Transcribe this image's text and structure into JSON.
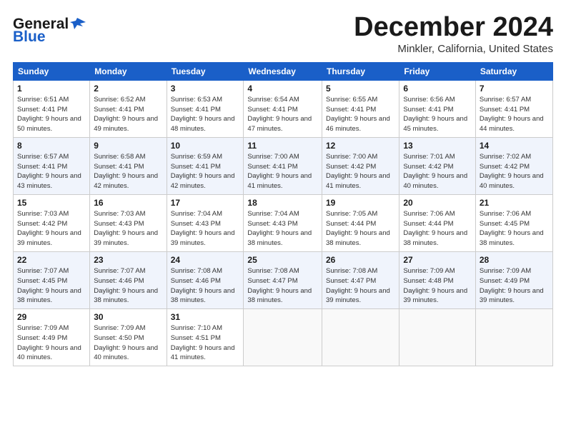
{
  "logo": {
    "general": "General",
    "blue": "Blue",
    "tagline": "Blue"
  },
  "title": "December 2024",
  "subtitle": "Minkler, California, United States",
  "headers": [
    "Sunday",
    "Monday",
    "Tuesday",
    "Wednesday",
    "Thursday",
    "Friday",
    "Saturday"
  ],
  "weeks": [
    [
      {
        "day": "1",
        "sunrise": "Sunrise: 6:51 AM",
        "sunset": "Sunset: 4:41 PM",
        "daylight": "Daylight: 9 hours and 50 minutes."
      },
      {
        "day": "2",
        "sunrise": "Sunrise: 6:52 AM",
        "sunset": "Sunset: 4:41 PM",
        "daylight": "Daylight: 9 hours and 49 minutes."
      },
      {
        "day": "3",
        "sunrise": "Sunrise: 6:53 AM",
        "sunset": "Sunset: 4:41 PM",
        "daylight": "Daylight: 9 hours and 48 minutes."
      },
      {
        "day": "4",
        "sunrise": "Sunrise: 6:54 AM",
        "sunset": "Sunset: 4:41 PM",
        "daylight": "Daylight: 9 hours and 47 minutes."
      },
      {
        "day": "5",
        "sunrise": "Sunrise: 6:55 AM",
        "sunset": "Sunset: 4:41 PM",
        "daylight": "Daylight: 9 hours and 46 minutes."
      },
      {
        "day": "6",
        "sunrise": "Sunrise: 6:56 AM",
        "sunset": "Sunset: 4:41 PM",
        "daylight": "Daylight: 9 hours and 45 minutes."
      },
      {
        "day": "7",
        "sunrise": "Sunrise: 6:57 AM",
        "sunset": "Sunset: 4:41 PM",
        "daylight": "Daylight: 9 hours and 44 minutes."
      }
    ],
    [
      {
        "day": "8",
        "sunrise": "Sunrise: 6:57 AM",
        "sunset": "Sunset: 4:41 PM",
        "daylight": "Daylight: 9 hours and 43 minutes."
      },
      {
        "day": "9",
        "sunrise": "Sunrise: 6:58 AM",
        "sunset": "Sunset: 4:41 PM",
        "daylight": "Daylight: 9 hours and 42 minutes."
      },
      {
        "day": "10",
        "sunrise": "Sunrise: 6:59 AM",
        "sunset": "Sunset: 4:41 PM",
        "daylight": "Daylight: 9 hours and 42 minutes."
      },
      {
        "day": "11",
        "sunrise": "Sunrise: 7:00 AM",
        "sunset": "Sunset: 4:41 PM",
        "daylight": "Daylight: 9 hours and 41 minutes."
      },
      {
        "day": "12",
        "sunrise": "Sunrise: 7:00 AM",
        "sunset": "Sunset: 4:42 PM",
        "daylight": "Daylight: 9 hours and 41 minutes."
      },
      {
        "day": "13",
        "sunrise": "Sunrise: 7:01 AM",
        "sunset": "Sunset: 4:42 PM",
        "daylight": "Daylight: 9 hours and 40 minutes."
      },
      {
        "day": "14",
        "sunrise": "Sunrise: 7:02 AM",
        "sunset": "Sunset: 4:42 PM",
        "daylight": "Daylight: 9 hours and 40 minutes."
      }
    ],
    [
      {
        "day": "15",
        "sunrise": "Sunrise: 7:03 AM",
        "sunset": "Sunset: 4:42 PM",
        "daylight": "Daylight: 9 hours and 39 minutes."
      },
      {
        "day": "16",
        "sunrise": "Sunrise: 7:03 AM",
        "sunset": "Sunset: 4:43 PM",
        "daylight": "Daylight: 9 hours and 39 minutes."
      },
      {
        "day": "17",
        "sunrise": "Sunrise: 7:04 AM",
        "sunset": "Sunset: 4:43 PM",
        "daylight": "Daylight: 9 hours and 39 minutes."
      },
      {
        "day": "18",
        "sunrise": "Sunrise: 7:04 AM",
        "sunset": "Sunset: 4:43 PM",
        "daylight": "Daylight: 9 hours and 38 minutes."
      },
      {
        "day": "19",
        "sunrise": "Sunrise: 7:05 AM",
        "sunset": "Sunset: 4:44 PM",
        "daylight": "Daylight: 9 hours and 38 minutes."
      },
      {
        "day": "20",
        "sunrise": "Sunrise: 7:06 AM",
        "sunset": "Sunset: 4:44 PM",
        "daylight": "Daylight: 9 hours and 38 minutes."
      },
      {
        "day": "21",
        "sunrise": "Sunrise: 7:06 AM",
        "sunset": "Sunset: 4:45 PM",
        "daylight": "Daylight: 9 hours and 38 minutes."
      }
    ],
    [
      {
        "day": "22",
        "sunrise": "Sunrise: 7:07 AM",
        "sunset": "Sunset: 4:45 PM",
        "daylight": "Daylight: 9 hours and 38 minutes."
      },
      {
        "day": "23",
        "sunrise": "Sunrise: 7:07 AM",
        "sunset": "Sunset: 4:46 PM",
        "daylight": "Daylight: 9 hours and 38 minutes."
      },
      {
        "day": "24",
        "sunrise": "Sunrise: 7:08 AM",
        "sunset": "Sunset: 4:46 PM",
        "daylight": "Daylight: 9 hours and 38 minutes."
      },
      {
        "day": "25",
        "sunrise": "Sunrise: 7:08 AM",
        "sunset": "Sunset: 4:47 PM",
        "daylight": "Daylight: 9 hours and 38 minutes."
      },
      {
        "day": "26",
        "sunrise": "Sunrise: 7:08 AM",
        "sunset": "Sunset: 4:47 PM",
        "daylight": "Daylight: 9 hours and 39 minutes."
      },
      {
        "day": "27",
        "sunrise": "Sunrise: 7:09 AM",
        "sunset": "Sunset: 4:48 PM",
        "daylight": "Daylight: 9 hours and 39 minutes."
      },
      {
        "day": "28",
        "sunrise": "Sunrise: 7:09 AM",
        "sunset": "Sunset: 4:49 PM",
        "daylight": "Daylight: 9 hours and 39 minutes."
      }
    ],
    [
      {
        "day": "29",
        "sunrise": "Sunrise: 7:09 AM",
        "sunset": "Sunset: 4:49 PM",
        "daylight": "Daylight: 9 hours and 40 minutes."
      },
      {
        "day": "30",
        "sunrise": "Sunrise: 7:09 AM",
        "sunset": "Sunset: 4:50 PM",
        "daylight": "Daylight: 9 hours and 40 minutes."
      },
      {
        "day": "31",
        "sunrise": "Sunrise: 7:10 AM",
        "sunset": "Sunset: 4:51 PM",
        "daylight": "Daylight: 9 hours and 41 minutes."
      },
      null,
      null,
      null,
      null
    ]
  ]
}
